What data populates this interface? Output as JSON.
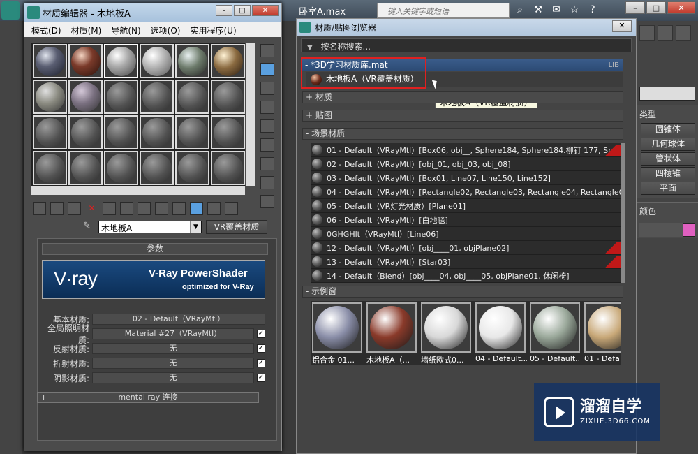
{
  "app": {
    "title": "卧室A.max",
    "search_placeholder": "键入关键字或短语",
    "right_panel": {
      "group_title": "类型",
      "buttons": [
        "圆锥体",
        "几何球体",
        "管状体",
        "四棱锥",
        "平面"
      ],
      "color_label": "颜色",
      "swatch_color": "#e060c0"
    }
  },
  "material_editor": {
    "title": "材质编辑器 - 木地板A",
    "menu": [
      "模式(D)",
      "材质(M)",
      "导航(N)",
      "选项(O)",
      "实用程序(U)"
    ],
    "material_name": "木地板A",
    "material_type": "VR覆盖材质",
    "rollout_title": "参数",
    "banner": {
      "logo": "V·ray",
      "line1": "V-Ray PowerShader",
      "line2": "optimized for V-Ray"
    },
    "params": [
      {
        "label": "基本材质:",
        "value": "02 - Default（VRayMtl）",
        "check": false
      },
      {
        "label": "全局照明材质:",
        "value": "Material #27（VRayMtl）",
        "check": true
      },
      {
        "label": "反射材质:",
        "value": "无",
        "check": true
      },
      {
        "label": "折射材质:",
        "value": "无",
        "check": true
      },
      {
        "label": "阴影材质:",
        "value": "无",
        "check": true
      }
    ],
    "mentalray_label": "mental ray 连接"
  },
  "browser": {
    "title": "材质/贴图浏览器",
    "search_label": "按名称搜索...",
    "library": {
      "name": "- *3D学习材质库.mat",
      "tag": "LIB",
      "item": "木地板A（VR覆盖材质）"
    },
    "tooltip": "木地板A（VR覆盖材质）",
    "sections": {
      "materials": "+ 材质",
      "maps": "+ 贴图",
      "scene": "- 场景材质",
      "samples": "- 示例窗"
    },
    "scene_materials": [
      {
        "text": "01 - Default（VRayMtl）[Box06, obj__, Sphere184, Sphere184.柳钉 177, Spher...",
        "flag": true
      },
      {
        "text": "02 - Default（VRayMtl）[obj_01, obj_03, obj_08]",
        "flag": false
      },
      {
        "text": "03 - Default（VRayMtl）[Box01, Line07, Line150, Line152]",
        "flag": false
      },
      {
        "text": "04 - Default（VRayMtl）[Rectangle02, Rectangle03, Rectangle04, Rectangle05,...",
        "flag": false
      },
      {
        "text": "05 - Default（VR灯光材质）[Plane01]",
        "flag": false
      },
      {
        "text": "06 - Default（VRayMtl）[白地毯]",
        "flag": false
      },
      {
        "text": "0GHGHlt（VRayMtl）[Line06]",
        "flag": false
      },
      {
        "text": "12 - Default（VRayMtl）[obj____01, objPlane02]",
        "flag": true
      },
      {
        "text": "13 - Default（VRayMtl）[Star03]",
        "flag": true
      },
      {
        "text": "14 - Default（Blend）[obj____04, obj____05, objPlane01, 休闲椅]",
        "flag": false
      }
    ],
    "sample_slots": [
      {
        "caption": "铝合金 01...",
        "color": "#8a8ea8"
      },
      {
        "caption": "木地板A（...",
        "color": "#8a3a2a"
      },
      {
        "caption": "墙纸欧式0...",
        "color": "#d8d8d8"
      },
      {
        "caption": "04 - Default...",
        "color": "#e8e8e8"
      },
      {
        "caption": "05 - Default...",
        "color": "#9aa89a"
      },
      {
        "caption": "01 - Defa",
        "color": "#c8a878"
      }
    ]
  },
  "watermark": {
    "title": "溜溜自学",
    "url": "ZIXUE.3D66.COM"
  }
}
